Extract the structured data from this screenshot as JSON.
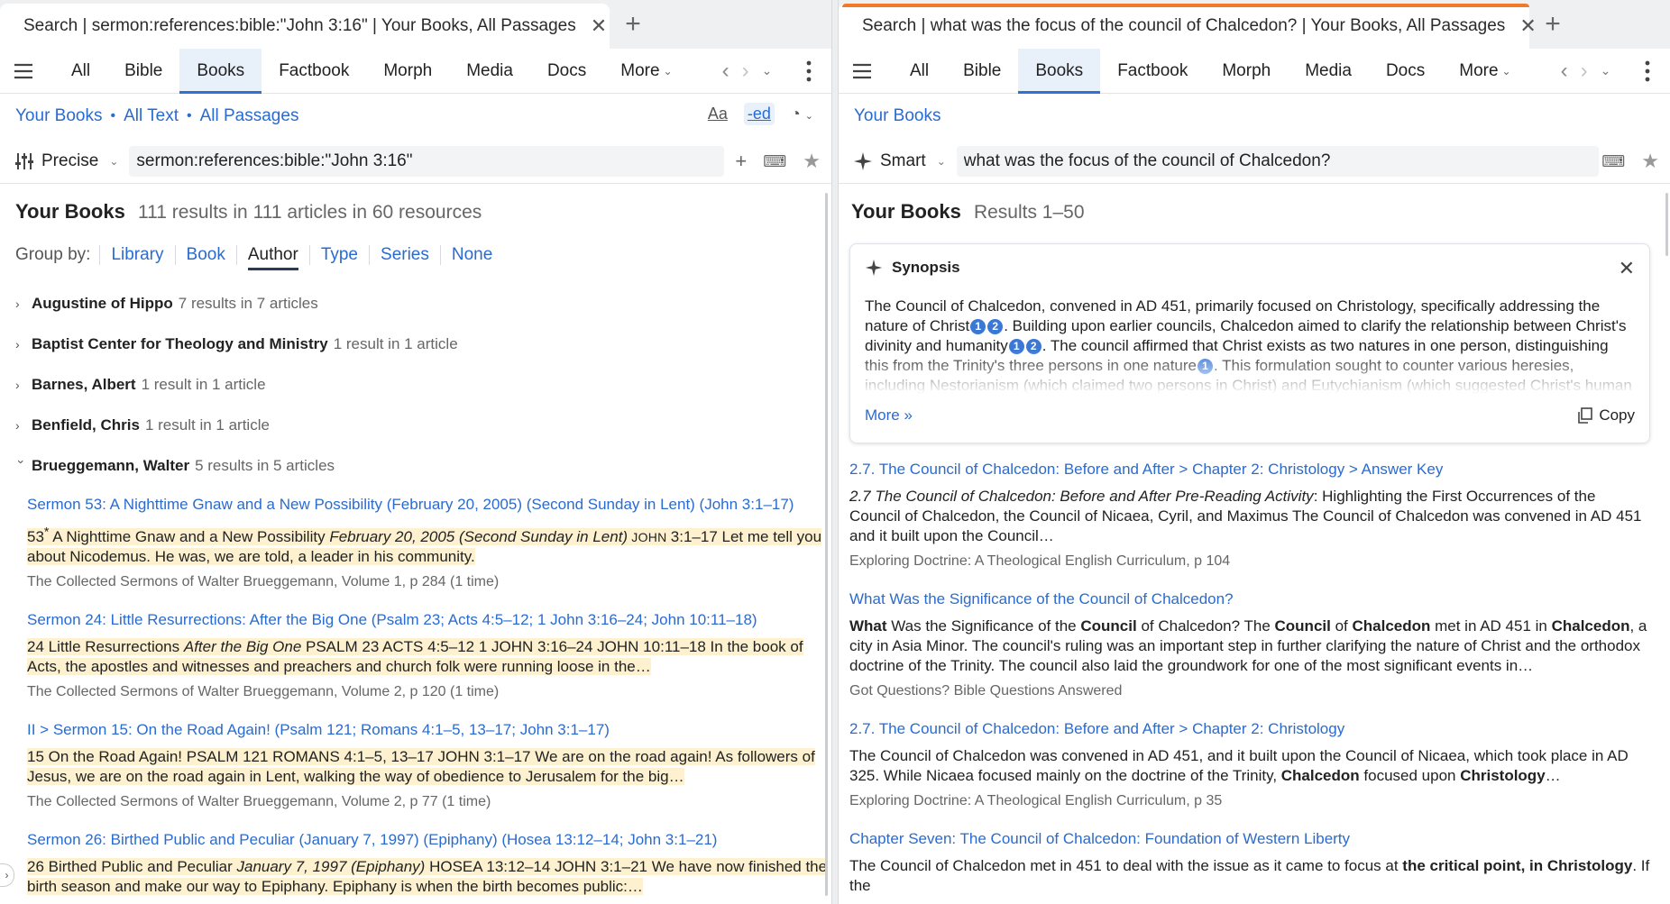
{
  "left": {
    "tab_title": "Search | sermon:references:bible:\"John 3:16\" | Your Books, All Passages",
    "nav_tabs": [
      "All",
      "Bible",
      "Books",
      "Factbook",
      "Morph",
      "Media",
      "Docs"
    ],
    "active_tab": "Books",
    "more_label": "More",
    "scope": [
      "Your Books",
      "All Text",
      "All Passages"
    ],
    "tools": {
      "font": "Aa",
      "ed": "-ed"
    },
    "mode_label": "Precise",
    "query": "sermon:references:bible:\"John 3:16\"",
    "summary_title": "Your Books",
    "summary_sub": "111 results in 111 articles in 60 resources",
    "groupby_label": "Group by:",
    "groupby": [
      "Library",
      "Book",
      "Author",
      "Type",
      "Series",
      "None"
    ],
    "groupby_active": "Author",
    "authors": [
      {
        "name": "Augustine of Hippo",
        "count": "7 results in 7 articles"
      },
      {
        "name": "Baptist Center for Theology and Ministry",
        "count": "1 result in 1 article"
      },
      {
        "name": "Barnes, Albert",
        "count": "1 result in 1 article"
      },
      {
        "name": "Benfield, Chris",
        "count": "1 result in 1 article"
      },
      {
        "name": "Brueggemann, Walter",
        "count": "5 results in 5 articles"
      }
    ],
    "results": [
      {
        "title": "Sermon 53: A Nighttime Gnaw and a New Possibility (February 20, 2005) (Second Sunday in Lent) (John 3:1–17)",
        "snippet_a": "53",
        "snippet_sup": "*",
        "snippet_b": " A Nighttime Gnaw and a New Possibility ",
        "snippet_i": "February 20, 2005 (Second Sunday in Lent)",
        "snippet_sc": " JOHN ",
        "snippet_c": "3:1–17 Let me tell you about Nicodemus. He was, we are told, a leader in his community.",
        "source": "The Collected Sermons of Walter Brueggemann, Volume 1, p 284 (1 time)"
      },
      {
        "title": "Sermon 24: Little Resurrections: After the Big One (Psalm 23; Acts 4:5–12; 1 John 3:16–24; John 10:11–18)",
        "snippet_a": "24 Little Resurrections ",
        "snippet_i": "After the Big One",
        "snippet_c": " PSALM 23 ACTS 4:5–12 1 JOHN 3:16–24 JOHN 10:11–18 In the book of Acts, the apostles and witnesses and preachers and church folk were running loose in the…",
        "source": "The Collected Sermons of Walter Brueggemann, Volume 2, p 120 (1 time)"
      },
      {
        "title": "II > Sermon 15: On the Road Again! (Psalm 121; Romans 4:1–5, 13–17; John 3:1–17)",
        "snippet_a": "15 On the Road Again! PSALM 121 ROMANS 4:1–5, 13–17 JOHN 3:1–17 We are on the road again! As followers of Jesus, we are on the road again in Lent, walking the way of obedience to Jerusalem for the big…",
        "source": "The Collected Sermons of Walter Brueggemann, Volume 2, p 77 (1 time)"
      },
      {
        "title": "Sermon 26: Birthed Public and Peculiar (January 7, 1997) (Epiphany) (Hosea 13:12–14; John 3:1–21)",
        "snippet_a": "26 Birthed Public and Peculiar ",
        "snippet_i": "January 7, 1997 (Epiphany)",
        "snippet_c": " HOSEA 13:12–14 JOHN 3:1–21 We have now finished the birth season and make our way to Epiphany. Epiphany is when the birth becomes public:…",
        "source": ""
      }
    ]
  },
  "right": {
    "tab_title": "Search | what was the focus of the council of Chalcedon? | Your Books, All Passages",
    "nav_tabs": [
      "All",
      "Bible",
      "Books",
      "Factbook",
      "Morph",
      "Media",
      "Docs"
    ],
    "active_tab": "Books",
    "more_label": "More",
    "scope": "Your Books",
    "mode_label": "Smart",
    "query": "what was the focus of the council of Chalcedon?",
    "summary_title": "Your Books",
    "summary_sub": "Results 1–50",
    "synopsis": {
      "title": "Synopsis",
      "p1": "The Council of Chalcedon, convened in AD 451, primarily focused on Christology, specifically addressing the nature of Christ",
      "p2": ". Building upon earlier councils, Chalcedon aimed to clarify the relationship between Christ's divinity and humanity",
      "p3": ". The council affirmed that Christ exists as two natures in one person, distinguishing this from the Trinity's three persons in one nature",
      "p4": ". This formulation sought to counter various heresies, including Nestorianism (which claimed two persons in Christ) and Eutychianism (which suggested Christ's human nature was",
      "cite1": "1",
      "cite2": "2",
      "more": "More »",
      "copy": "Copy"
    },
    "results": [
      {
        "title": "2.7. The Council of Chalcedon: Before and After > Chapter 2: Christology > Answer Key",
        "snippet_i": "2.7 The Council of Chalcedon: Before and After Pre-Reading Activity",
        "snippet_c": ": Highlighting the First Occurrences of the Council of Chalcedon, the Council of Nicaea, Cyril, and Maximus The Council of Chalcedon was convened in AD 451 and it built upon the Council…",
        "source": "Exploring Doctrine: A Theological English Curriculum, p 104"
      },
      {
        "title": "What Was the Significance of the Council of Chalcedon?",
        "b1": "What",
        "t1": " Was the Significance of the ",
        "b2": "Council",
        "t2": " of Chalcedon? The ",
        "b3": "Council",
        "t3": " of ",
        "b4": "Chalcedon",
        "t4": " met in AD 451 in ",
        "b5": "Chalcedon",
        "t5": ", a city in Asia Minor. The council's ruling was an important step in further clarifying the nature of Christ and the orthodox doctrine of the Trinity. The council also laid the groundwork for one of the most significant events in…",
        "source": "Got Questions? Bible Questions Answered"
      },
      {
        "title": "2.7. The Council of Chalcedon: Before and After > Chapter 2: Christology",
        "t1": "The Council of Chalcedon was convened in AD 451, and it built upon the Council of Nicaea, which took place in AD 325. While Nicaea focused mainly on the doctrine of the Trinity, ",
        "b1": "Chalcedon",
        "t2": " focused upon ",
        "b2": "Christology",
        "t3": "…",
        "source": "Exploring Doctrine: A Theological English Curriculum, p 35"
      },
      {
        "title": "Chapter Seven: The Council of Chalcedon: Foundation of Western Liberty",
        "t1": "The Council of Chalcedon met in 451 to deal with the issue as it came to focus at ",
        "b1": "the critical point, in Christology",
        "t2": ". If the",
        "source": ""
      }
    ]
  }
}
